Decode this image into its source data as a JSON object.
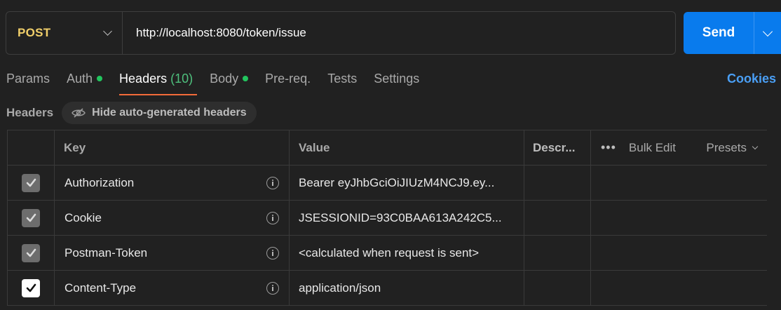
{
  "request": {
    "method": "POST",
    "url": "http://localhost:8080/token/issue",
    "send_label": "Send"
  },
  "tabs": [
    {
      "label": "Params",
      "count": "",
      "dot": false,
      "active": false
    },
    {
      "label": "Auth",
      "count": "",
      "dot": true,
      "active": false
    },
    {
      "label": "Headers",
      "count": "(10)",
      "dot": false,
      "active": true
    },
    {
      "label": "Body",
      "count": "",
      "dot": true,
      "active": false
    },
    {
      "label": "Pre-req.",
      "count": "",
      "dot": false,
      "active": false
    },
    {
      "label": "Tests",
      "count": "",
      "dot": false,
      "active": false
    },
    {
      "label": "Settings",
      "count": "",
      "dot": false,
      "active": false
    }
  ],
  "cookies_label": "Cookies",
  "headers_section": {
    "label": "Headers",
    "hide_autogen_label": "Hide auto-generated headers"
  },
  "table": {
    "columns": {
      "key": "Key",
      "value": "Value",
      "description": "Descr...",
      "more": "•••",
      "bulk_edit": "Bulk Edit",
      "presets": "Presets"
    },
    "rows": [
      {
        "key": "Authorization",
        "value": "Bearer eyJhbGciOiJIUzM4NCJ9.ey...",
        "checkbox": "muted"
      },
      {
        "key": "Cookie",
        "value": "JSESSIONID=93C0BAA613A242C5...",
        "checkbox": "muted"
      },
      {
        "key": "Postman-Token",
        "value": "<calculated when request is sent>",
        "checkbox": "muted"
      },
      {
        "key": "Content-Type",
        "value": "application/json",
        "checkbox": "bright"
      }
    ]
  },
  "colors": {
    "method": "#f1cf6a",
    "send": "#097bed",
    "tab_active_underline": "#f26b3a",
    "count": "#4ec07d",
    "dot": "#22c55e",
    "cookies": "#4a9ff5"
  }
}
